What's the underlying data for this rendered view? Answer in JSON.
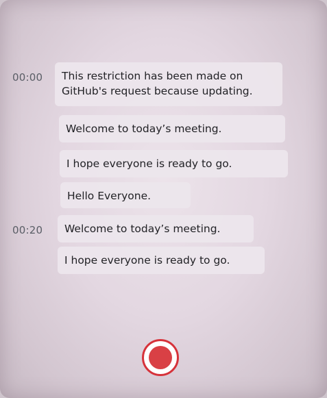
{
  "transcript": {
    "timestamps": [
      "00:00",
      "00:20"
    ],
    "messages": [
      {
        "text_line1": "This restriction has been made on",
        "text_line2": "GitHub's request because updating."
      },
      {
        "text": "Welcome to today’s meeting."
      },
      {
        "text": "I hope everyone is ready to go."
      },
      {
        "text": "Hello Everyone."
      },
      {
        "text": "Welcome to today’s meeting."
      },
      {
        "text": "I hope everyone is ready to go."
      }
    ]
  },
  "controls": {
    "record_button_icon": "record-icon",
    "record_color": "#d94045"
  }
}
